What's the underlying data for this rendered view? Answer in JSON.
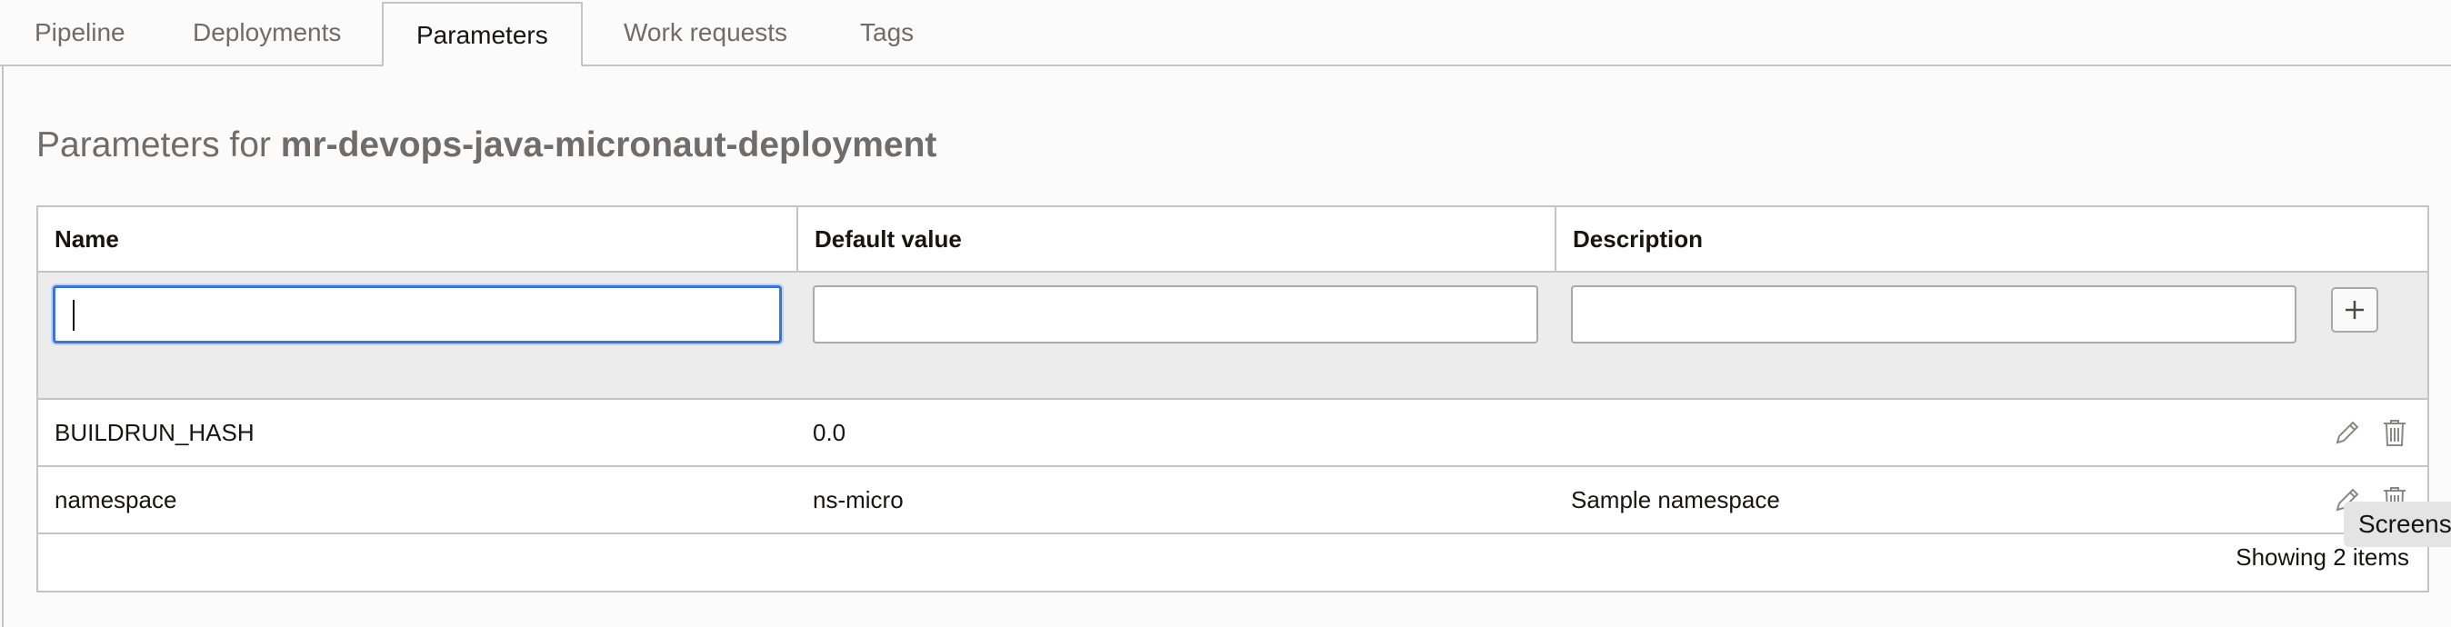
{
  "tabs": [
    {
      "label": "Pipeline"
    },
    {
      "label": "Deployments"
    },
    {
      "label": "Parameters"
    },
    {
      "label": "Work requests"
    },
    {
      "label": "Tags"
    }
  ],
  "active_tab": "Parameters",
  "page": {
    "title_prefix": "Parameters for",
    "title_name": "mr-devops-java-micronaut-deployment"
  },
  "table": {
    "columns": [
      "Name",
      "Default value",
      "Description"
    ],
    "new_row": {
      "name": "",
      "default_value": "",
      "description": ""
    },
    "rows": [
      {
        "name": "BUILDRUN_HASH",
        "default_value": "0.0",
        "description": ""
      },
      {
        "name": "namespace",
        "default_value": "ns-micro",
        "description": "Sample namespace"
      }
    ],
    "footer": "Showing 2 items"
  },
  "tooltip": "Screenshot",
  "icons": {
    "add": "plus-icon",
    "edit": "pencil-icon",
    "delete": "trash-icon"
  },
  "colors": {
    "focus": "#3b73d6",
    "border": "#c4c4c4",
    "muted_text": "#6f6c69"
  }
}
